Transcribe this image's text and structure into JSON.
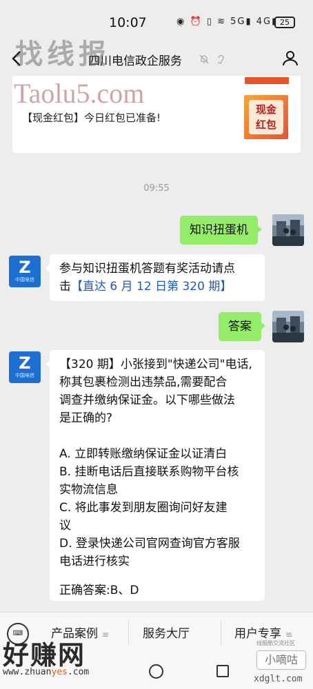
{
  "status_bar": {
    "time": "10:07",
    "icons_text": "◉ ⏰ ▯ ≋ 5G▮ 4G▮",
    "battery": "25"
  },
  "header": {
    "title": "四川电信政企服务"
  },
  "promo_card": {
    "text": "【现金红包】今日红包已准备!",
    "thumb_line1": "现金",
    "thumb_line2": "红包"
  },
  "chat": {
    "timestamp": "09:55",
    "messages": [
      {
        "from": "me",
        "text": "知识扭蛋机"
      },
      {
        "from": "bot",
        "lines": [
          "参与知识扭蛋机答题有奖活动请点",
          "击"
        ],
        "link_text": "【直达 6 月 12 日第 320 期】"
      },
      {
        "from": "me",
        "text": "答案"
      },
      {
        "from": "bot",
        "lines": [
          "【320 期】小张接到\"快递公司\"电话,",
          "称其包裹检测出违禁品,需要配合",
          "调查并缴纳保证金。以下哪些做法",
          "是正确的?",
          "",
          "A. 立即转账缴纳保证金以证清白",
          "B. 挂断电话后直接联系购物平台核",
          "实物流信息",
          "C. 将此事发到朋友圈询问好友建",
          "议",
          "D. 登录快递公司官网查询官方客服",
          "电话进行核实",
          "",
          "正确答案:B、D"
        ]
      }
    ],
    "bot_avatar_caption": "中国电信"
  },
  "menu": {
    "items": [
      "产品案例",
      "服务大厅",
      "用户专享"
    ],
    "keyboard_label": "⌨"
  },
  "watermarks": {
    "top_title": "找线报",
    "top_domain": "Taolu5.com",
    "bottom_logo": "好赚网",
    "bottom_url_pre": "www.zhuan",
    "bottom_url_mid": "yes",
    "bottom_url_post": ".com",
    "community": "线报酷交流社区",
    "badge": "小嘀咕",
    "site": "xdglt.com"
  },
  "colors": {
    "me_bubble": "#95ec69",
    "link": "#1e59c8",
    "bot_avatar": "#1b6fd0"
  }
}
